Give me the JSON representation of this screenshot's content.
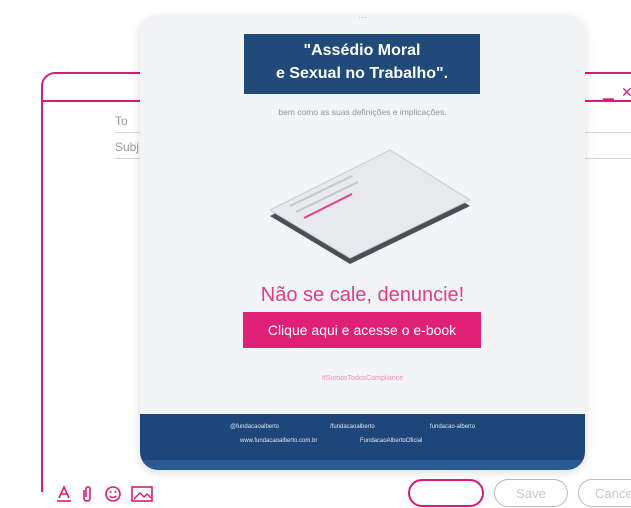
{
  "compose": {
    "to_label": "To",
    "subject_label": "Subj",
    "minimize_icon": "minimize-icon",
    "close_icon": "close-icon"
  },
  "toolbar": {
    "icons": [
      "format-text-icon",
      "attach-icon",
      "emoji-icon",
      "image-icon"
    ],
    "send_label": "",
    "save_label": "Save",
    "cancel_label": "Cance"
  },
  "preview": {
    "top_faint_text": "...",
    "title_line1": "\"Assédio Moral",
    "title_line2": "e Sexual no Trabalho\".",
    "subtitle": "bem como as suas definições e implicações.",
    "headline": "Não se cale, denuncie!",
    "cta": "Clique aqui e acesse o e-book",
    "hashtag": "#SomosTodosCompliance",
    "footer": {
      "row1_a": "@fundacaoalberto",
      "row1_b": "/fundacaoalberto",
      "row1_c": "fundacao-alberto",
      "row2_a": "www.fundacaoalberto.com.br",
      "row2_b": "FundacaoAlbertoOficial"
    }
  },
  "colors": {
    "accent": "#d81b7a",
    "navy": "#1f4a7a",
    "cta": "#e01f76"
  }
}
